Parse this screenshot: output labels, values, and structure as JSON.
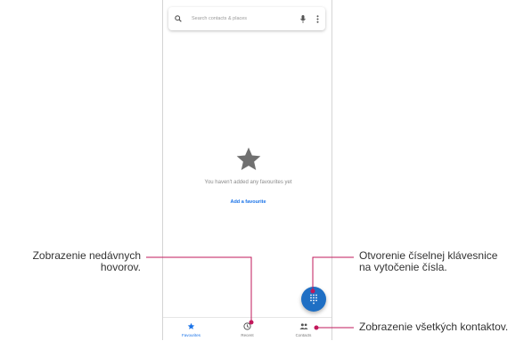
{
  "search": {
    "placeholder": "Search contacts & places"
  },
  "empty_state": {
    "message": "You haven't added any favourites yet",
    "add_link": "Add a favourite"
  },
  "nav": {
    "items": [
      {
        "label": "Favourites",
        "icon": "star-icon",
        "active": true
      },
      {
        "label": "Recent",
        "icon": "clock-icon",
        "active": false
      },
      {
        "label": "Contacts",
        "icon": "people-icon",
        "active": false
      }
    ]
  },
  "callouts": {
    "recent": {
      "line1": "Zobrazenie nedávnych",
      "line2": "hovorov."
    },
    "dialpad": {
      "line1": "Otvorenie číselnej klávesnice",
      "line2": "na vytočenie čísla."
    },
    "contacts": {
      "line1": "Zobrazenie všetkých kontaktov."
    }
  },
  "colors": {
    "accent": "#1a73e8",
    "fab": "#1f6fc4",
    "callout_line": "#c2185b",
    "star_gray": "#707070"
  }
}
